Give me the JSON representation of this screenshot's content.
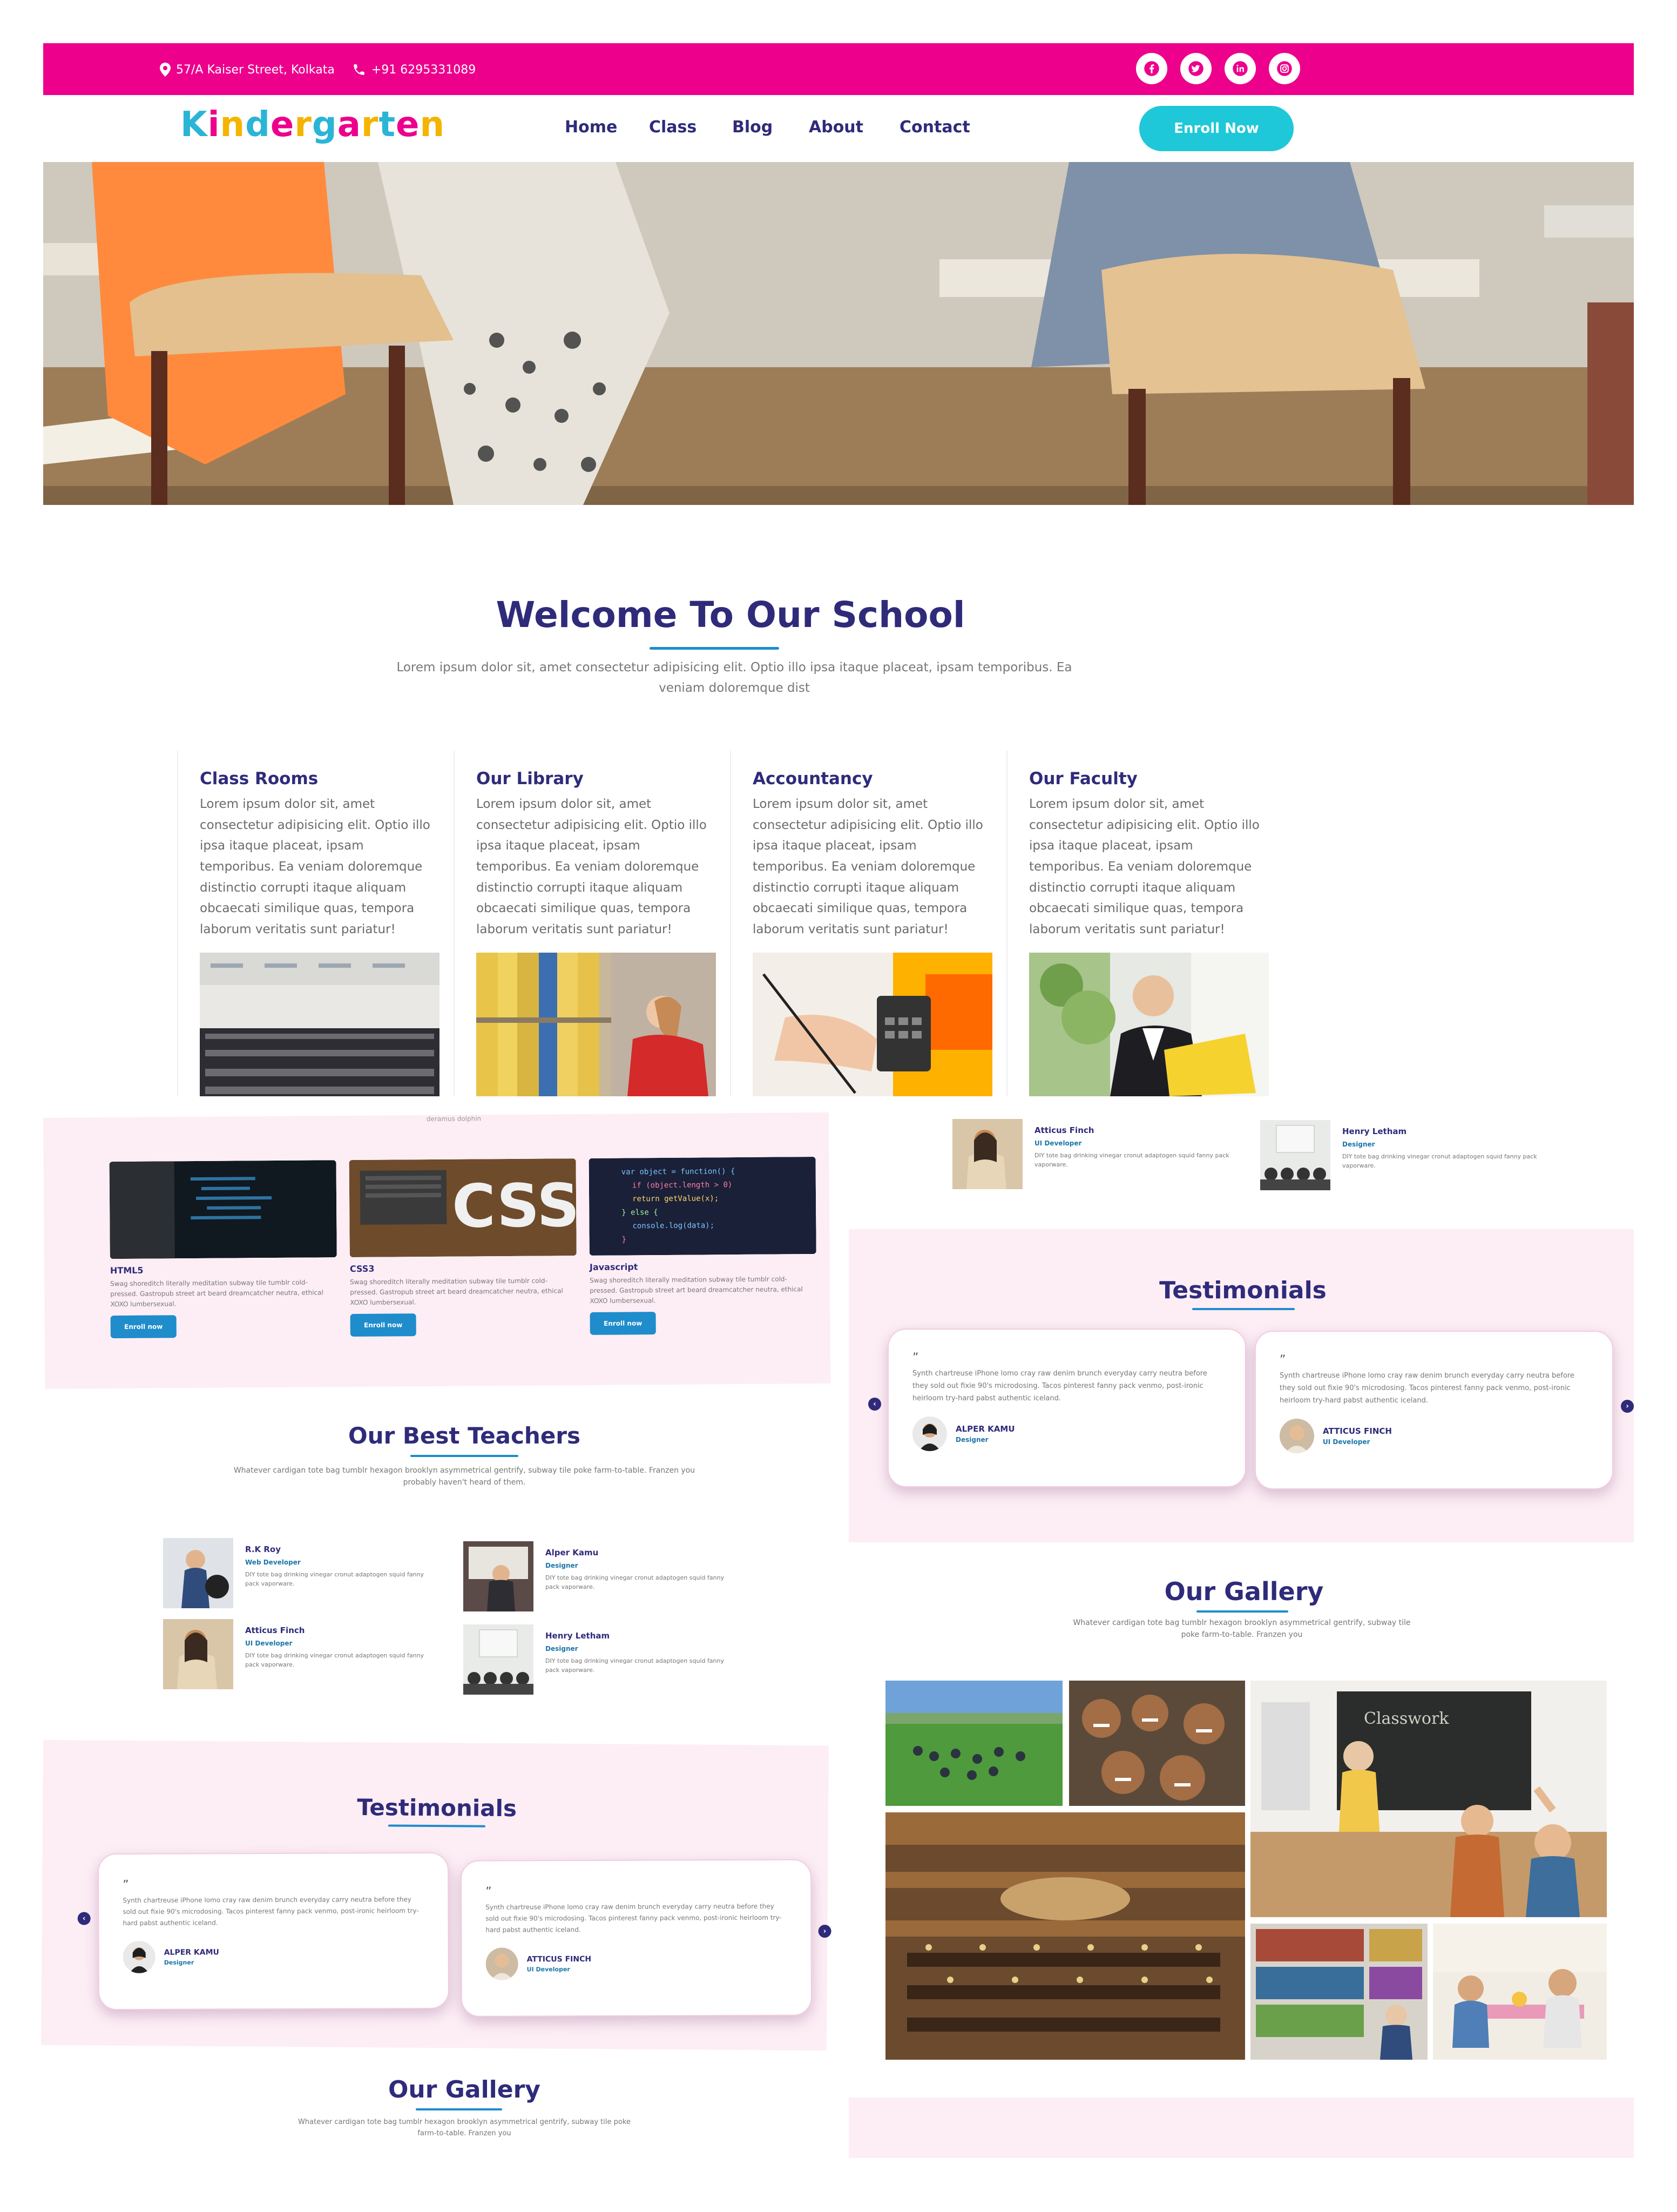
{
  "topbar": {
    "address": "57/A Kaiser Street, Kolkata",
    "phone": "+91 6295331089",
    "social_icons": [
      "facebook-icon",
      "twitter-icon",
      "linkedin-icon",
      "instagram-icon"
    ],
    "color": "#ec008c"
  },
  "header": {
    "logo": [
      "K",
      "i",
      "n",
      "d",
      "e",
      "r",
      "g",
      "a",
      "r",
      "t",
      "e",
      "n"
    ],
    "logo_colors": [
      "#2ab5d6",
      "#ec008c",
      "#f4b400",
      "#2ab5d6",
      "#ec008c",
      "#f4b400",
      "#2ab5d6",
      "#ec008c",
      "#f4b400",
      "#2ab5d6",
      "#ec008c",
      "#f4b400"
    ],
    "nav": [
      "Home",
      "Class",
      "Blog",
      "About",
      "Contact"
    ],
    "cta": "Enroll Now",
    "cta_color": "#1fc8d8"
  },
  "welcome": {
    "title": "Welcome To Our School",
    "text": "Lorem ipsum dolor sit, amet consectetur adipisicing elit. Optio illo ipsa itaque placeat, ipsam temporibus. Ea veniam doloremque dist",
    "cards": [
      {
        "title": "Class Rooms",
        "text": "Lorem ipsum dolor sit, amet consectetur adipisicing elit. Optio illo ipsa itaque placeat, ipsam temporibus. Ea veniam doloremque distinctio corrupti itaque aliquam obcaecati similique quas, tempora laborum veritatis sunt pariatur!"
      },
      {
        "title": "Our Library",
        "text": "Lorem ipsum dolor sit, amet consectetur adipisicing elit. Optio illo ipsa itaque placeat, ipsam temporibus. Ea veniam doloremque distinctio corrupti itaque aliquam obcaecati similique quas, tempora laborum veritatis sunt pariatur!"
      },
      {
        "title": "Accountancy",
        "text": "Lorem ipsum dolor sit, amet consectetur adipisicing elit. Optio illo ipsa itaque placeat, ipsam temporibus. Ea veniam doloremque distinctio corrupti itaque aliquam obcaecati similique quas, tempora laborum veritatis sunt pariatur!"
      },
      {
        "title": "Our Faculty",
        "text": "Lorem ipsum dolor sit, amet consectetur adipisicing elit. Optio illo ipsa itaque placeat, ipsam temporibus. Ea veniam doloremque distinctio corrupti itaque aliquam obcaecati similique quas, tempora laborum veritatis sunt pariatur!"
      }
    ]
  },
  "courses": {
    "cut_text": "deramus dolphin",
    "items": [
      {
        "title": "HTML5",
        "text": "Swag shoreditch literally meditation subway tile tumblr cold-pressed. Gastropub street art beard dreamcatcher neutra, ethical XOXO lumbersexual.",
        "button": "Enroll now"
      },
      {
        "title": "CSS3",
        "text": "Swag shoreditch literally meditation subway tile tumblr cold-pressed. Gastropub street art beard dreamcatcher neutra, ethical XOXO lumbersexual.",
        "button": "Enroll now"
      },
      {
        "title": "Javascript",
        "text": "Swag shoreditch literally meditation subway tile tumblr cold-pressed. Gastropub street art beard dreamcatcher neutra, ethical XOXO lumbersexual.",
        "button": "Enroll now"
      }
    ]
  },
  "teachers": {
    "title_a": "Our",
    "title_b": "Best Teachers",
    "text": "Whatever cardigan tote bag tumblr hexagon brooklyn asymmetrical gentrify, subway tile poke farm-to-table. Franzen you probably haven't heard of them.",
    "items": [
      {
        "name": "R.K Roy",
        "role": "Web Developer",
        "text": "DIY tote bag drinking vinegar cronut adaptogen squid fanny pack vaporware."
      },
      {
        "name": "Alper Kamu",
        "role": "Designer",
        "text": "DIY tote bag drinking vinegar cronut adaptogen squid fanny pack vaporware."
      },
      {
        "name": "Atticus Finch",
        "role": "UI Developer",
        "text": "DIY tote bag drinking vinegar cronut adaptogen squid fanny pack vaporware."
      },
      {
        "name": "Henry Letham",
        "role": "Designer",
        "text": "DIY tote bag drinking vinegar cronut adaptogen squid fanny pack vaporware."
      }
    ]
  },
  "right_teachers": [
    {
      "name": "Atticus Finch",
      "role": "UI Developer",
      "text": "DIY tote bag drinking vinegar cronut adaptogen squid fanny pack vaporware."
    },
    {
      "name": "Henry Letham",
      "role": "Designer",
      "text": "DIY tote bag drinking vinegar cronut adaptogen squid fanny pack vaporware."
    }
  ],
  "testimonials": {
    "title": "Testimonials",
    "quote_mark": "”",
    "items": [
      {
        "text": "Synth chartreuse iPhone lomo cray raw denim brunch everyday carry neutra before they sold out fixie 90's microdosing. Tacos pinterest fanny pack venmo, post-ironic heirloom try-hard pabst authentic iceland.",
        "name": "ALPER KAMU",
        "role": "Designer"
      },
      {
        "text": "Synth chartreuse iPhone lomo cray raw denim brunch everyday carry neutra before they sold out fixie 90's microdosing. Tacos pinterest fanny pack venmo, post-ironic heirloom try-hard pabst authentic iceland.",
        "name": "ATTICUS FINCH",
        "role": "UI Developer"
      }
    ],
    "prev": "‹",
    "next": "›"
  },
  "gallery": {
    "title": "Our Gallery",
    "text": "Whatever cardigan tote bag tumblr hexagon brooklyn asymmetrical gentrify, subway tile poke farm-to-table. Franzen you"
  },
  "gallery_chalk": "Classwork"
}
